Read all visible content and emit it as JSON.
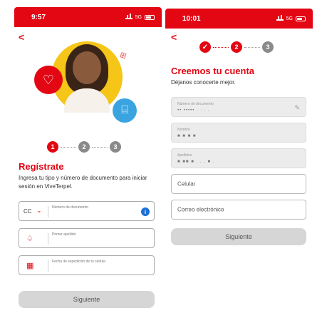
{
  "left": {
    "status": {
      "time": "9:57",
      "network": "5G"
    },
    "steps": [
      "1",
      "2",
      "3"
    ],
    "title": "Regístrate",
    "subtitle": "Ingresa tu tipo y número de documento para iniciar sesión en ViveTerpel.",
    "doc_field": {
      "type_value": "CC",
      "label": "Número de documento"
    },
    "surname_field": {
      "label": "Primer apellido"
    },
    "date_field": {
      "label": "Fecha de expedición de tu cédula"
    },
    "button": "Siguiente"
  },
  "right": {
    "status": {
      "time": "10:01",
      "network": "5G"
    },
    "steps": [
      "✓",
      "2",
      "3"
    ],
    "title": "Creemos tu cuenta",
    "subtitle": "Déjanos conocerte mejor.",
    "fields": {
      "documento": {
        "label": "Número de documento",
        "value": "•• ••••• . . . ."
      },
      "nombre": {
        "label": "Nombre",
        "value": "■   ■   ■     ■"
      },
      "apellidos": {
        "label": "Apellidos",
        "value": "■   ■■   ■ . . .  ■ ."
      },
      "celular": "Celular",
      "correo": "Correo electrónico"
    },
    "button": "Siguiente"
  },
  "colors": {
    "brand_red": "#e30613",
    "hero_yellow": "#f5c518",
    "gift_blue": "#3aa4e0",
    "info_blue": "#1d6fd6"
  },
  "icons": [
    "back-arrow-icon",
    "heart-icon",
    "gift-icon",
    "chevron-down-icon",
    "info-icon",
    "user-outline-icon",
    "calendar-icon",
    "edit-icon",
    "check-icon",
    "signal-icon",
    "battery-icon"
  ]
}
